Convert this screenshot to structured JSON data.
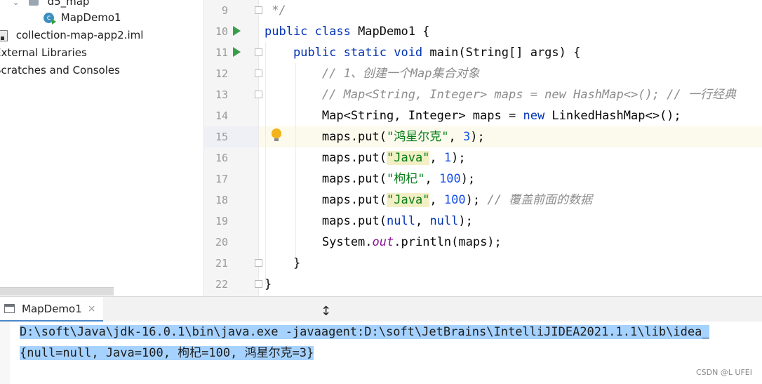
{
  "project_tree": {
    "package_name": "d5_map",
    "class_item": "MapDemo1",
    "iml_file": "collection-map-app2.iml",
    "external_libraries": "External Libraries",
    "scratches": "Scratches and Consoles"
  },
  "editor": {
    "line_numbers": [
      "9",
      "10",
      "11",
      "12",
      "13",
      "14",
      "15",
      "16",
      "17",
      "18",
      "19",
      "20",
      "21",
      "22"
    ],
    "lines": {
      "l9": " */",
      "l10_kw": "public class ",
      "l10_rest": "MapDemo1 {",
      "l11_kw": "    public static void ",
      "l11_rest": "main(String[] args) {",
      "l12_comment": "        // 1、创建一个Map集合对象",
      "l13_comment": "        // Map<String, Integer> maps = new HashMap<>(); // 一行经典",
      "l14_a": "        Map<String, Integer> maps = ",
      "l14_kw": "new ",
      "l14_b": "LinkedHashMap<>();",
      "put_prefix": "        maps.put(",
      "l15_str": "\"鸿星尔克\"",
      "l15_num": "3",
      "l16_str": "\"Java\"",
      "l16_num": "1",
      "l17_str": "\"枸杞\"",
      "l17_num": "100",
      "l18_str": "\"Java\"",
      "l18_num": "100",
      "l18_comment": " // 覆盖前面的数据",
      "l19_null": "null",
      "l20_a": "        System.",
      "l20_field": "out",
      "l20_b": ".println(maps);",
      "l21": "    }",
      "l22": "}",
      "sep": ", ",
      "close": ");"
    }
  },
  "run_panel": {
    "tab_label": "MapDemo1",
    "close_glyph": "×",
    "command_line": "D:\\soft\\Java\\jdk-16.0.1\\bin\\java.exe -javaagent:D:\\soft\\JetBrains\\IntelliJIDEA2021.1.1\\lib\\idea_",
    "output_line": "{null=null, Java=100, 枸杞=100, 鸿星尔克=3}"
  },
  "watermark": "CSDN @L UFEI",
  "colors": {
    "keyword": "#0033b3",
    "comment": "#8c8c8c",
    "string": "#067d17",
    "number": "#1750eb",
    "selection": "#a6d2ff"
  }
}
